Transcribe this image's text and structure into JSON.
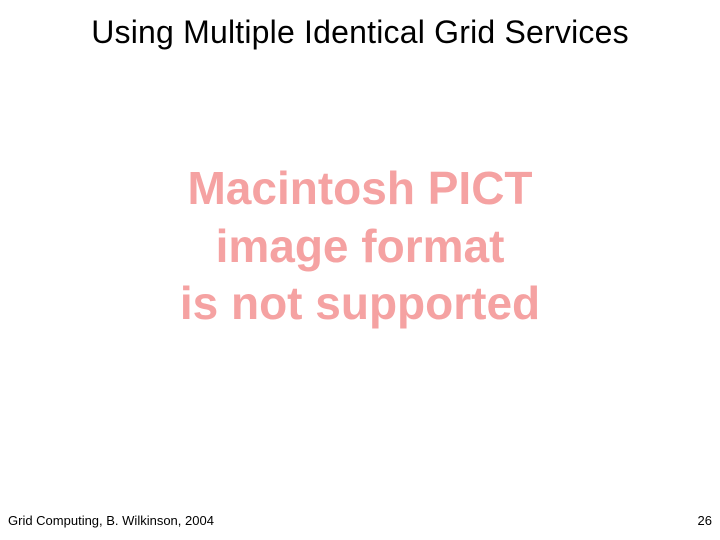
{
  "title": "Using Multiple Identical Grid Services",
  "placeholder": {
    "line1": "Macintosh PICT",
    "line2": "image format",
    "line3": "is not supported"
  },
  "footer": {
    "left": "Grid Computing, B. Wilkinson, 2004",
    "right": "26"
  }
}
